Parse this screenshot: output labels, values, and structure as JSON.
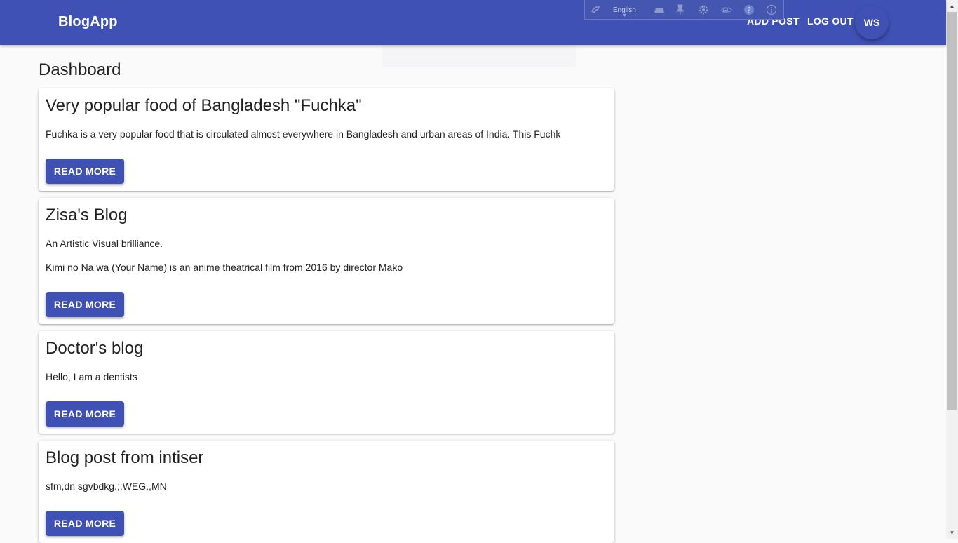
{
  "header": {
    "brand": "BlogApp",
    "add_post_label": "ADD POST",
    "logout_label": "LOG OUT",
    "avatar_initials": "WS",
    "color": "#3f51b5"
  },
  "translator_toolbar": {
    "language": "English",
    "icons": [
      "speaker-icon",
      "dictionary-icon",
      "pin-icon",
      "gear-icon",
      "browser-icon",
      "help-icon",
      "info-icon"
    ]
  },
  "page": {
    "title": "Dashboard"
  },
  "posts": [
    {
      "title": "Very popular food of Bangladesh \"Fuchka\"",
      "lines": [
        "Fuchka is a very popular food that is circulated almost everywhere in Bangladesh and urban areas of India. This Fuchk"
      ],
      "button_label": "READ MORE"
    },
    {
      "title": "Zisa's Blog",
      "lines": [
        "An Artistic Visual brilliance.",
        "Kimi no Na wa (Your Name) is an anime theatrical film from 2016 by director Mako"
      ],
      "button_label": "READ MORE"
    },
    {
      "title": "Doctor's blog",
      "lines": [
        "Hello, I am a dentists"
      ],
      "button_label": "READ MORE"
    },
    {
      "title": "Blog post from intiser",
      "lines": [
        "sfm,dn sgvbdkg.;;WEG.,MN"
      ],
      "button_label": "READ MORE"
    }
  ]
}
